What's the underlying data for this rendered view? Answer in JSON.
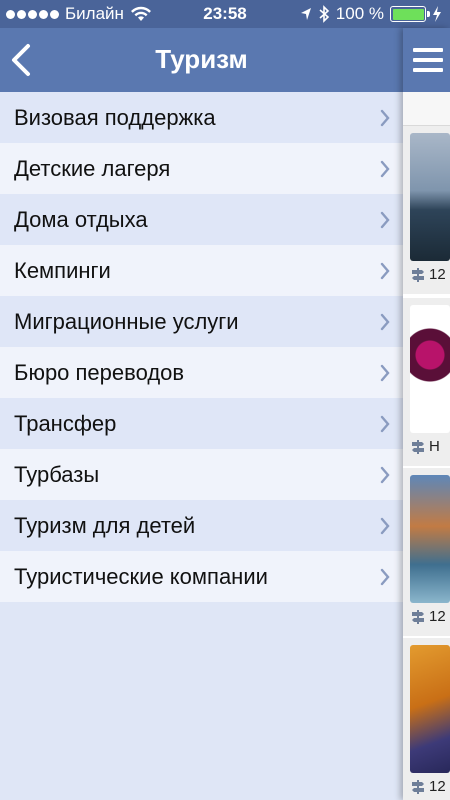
{
  "status_bar": {
    "carrier": "Билайн",
    "time": "23:58",
    "battery_percent": "100 %",
    "battery_level": 1.0
  },
  "nav": {
    "title": "Туризм",
    "back_icon": "chevron-left-icon"
  },
  "menu": {
    "items": [
      {
        "label": "Визовая поддержка"
      },
      {
        "label": "Детские лагеря"
      },
      {
        "label": "Дома отдыха"
      },
      {
        "label": "Кемпинги"
      },
      {
        "label": "Миграционные услуги"
      },
      {
        "label": "Бюро переводов"
      },
      {
        "label": "Трансфер"
      },
      {
        "label": "Турбазы"
      },
      {
        "label": "Туризм для детей"
      },
      {
        "label": "Туристические компании"
      }
    ]
  },
  "panel": {
    "menu_icon": "hamburger-menu-icon",
    "cards": [
      {
        "caption": "12"
      },
      {
        "caption": "Н"
      },
      {
        "caption": "12"
      },
      {
        "caption": "12"
      }
    ]
  },
  "colors": {
    "nav": "#5a78b0",
    "status": "#4a6499",
    "row_odd": "#dfe6f7",
    "row_even": "#f0f3fb"
  }
}
